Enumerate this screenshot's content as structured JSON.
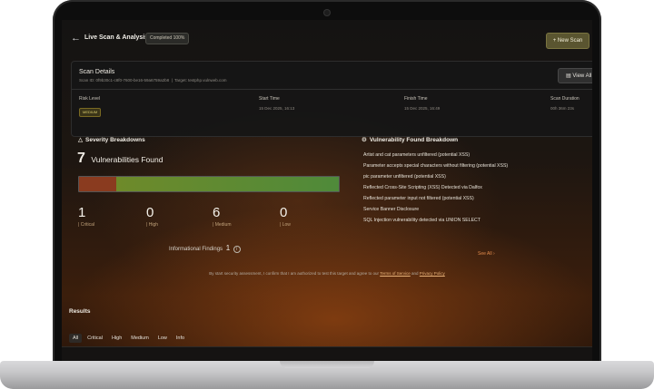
{
  "header": {
    "back_icon": "arrow-left-icon",
    "title": "Live Scan & Analysis",
    "status_badge": "Completed 100%",
    "new_scan_label": "New Scan"
  },
  "scan_details": {
    "heading": "Scan Details",
    "scan_id": "Scan ID: 0f9b30c1-c8f0-7600-be16-59a6759a2b8",
    "target": "Target: testphp.vulnweb.com",
    "view_all_label": "View All",
    "risk_level_label": "Risk Level",
    "risk_level_value": "MEDIUM",
    "start_time_label": "Start Time",
    "start_time_value": "15 Dec 2025, 16:13",
    "finish_time_label": "Finish Time",
    "finish_time_value": "15 Dec 2025, 16:49",
    "scan_duration_label": "Scan Duration",
    "scan_duration_value": "00h 36m 23s"
  },
  "severity": {
    "title": "Severity Breakdowns",
    "total_count": "7",
    "total_label": "Vulnerabilities Found",
    "items": [
      {
        "count": "1",
        "label": "Critical"
      },
      {
        "count": "0",
        "label": "High"
      },
      {
        "count": "6",
        "label": "Medium"
      },
      {
        "count": "0",
        "label": "Low"
      }
    ],
    "informational_label": "Informational Findings",
    "informational_count": "1",
    "colors": {
      "critical": "#8a3b1f",
      "medium": "#6e8a2a"
    }
  },
  "breakdown": {
    "title": "Vulnerability Found Breakdown",
    "items": [
      "Artist and cat parameters unfiltered (potential XSS)",
      "Parameter accepts special characters without filtering (potential XSS)",
      "pic parameter unfiltered (potential XSS)",
      "Reflected Cross-Site Scripting (XSS) Detected via Dalfox",
      "Reflected parameter input not filtered (potential XSS)",
      "Service Banner Disclosure",
      "SQL Injection vulnerability detected via UNION SELECT"
    ],
    "see_all_label": "See All"
  },
  "consent": {
    "text": "By start security assessment, I confirm that I am authorized to test this target and agree to our",
    "terms_label": "Terms of Service",
    "and_label": "and",
    "privacy_label": "Privacy Policy"
  },
  "results": {
    "title": "Results",
    "filters": [
      "All",
      "Critical",
      "High",
      "Medium",
      "Low",
      "Info"
    ]
  }
}
